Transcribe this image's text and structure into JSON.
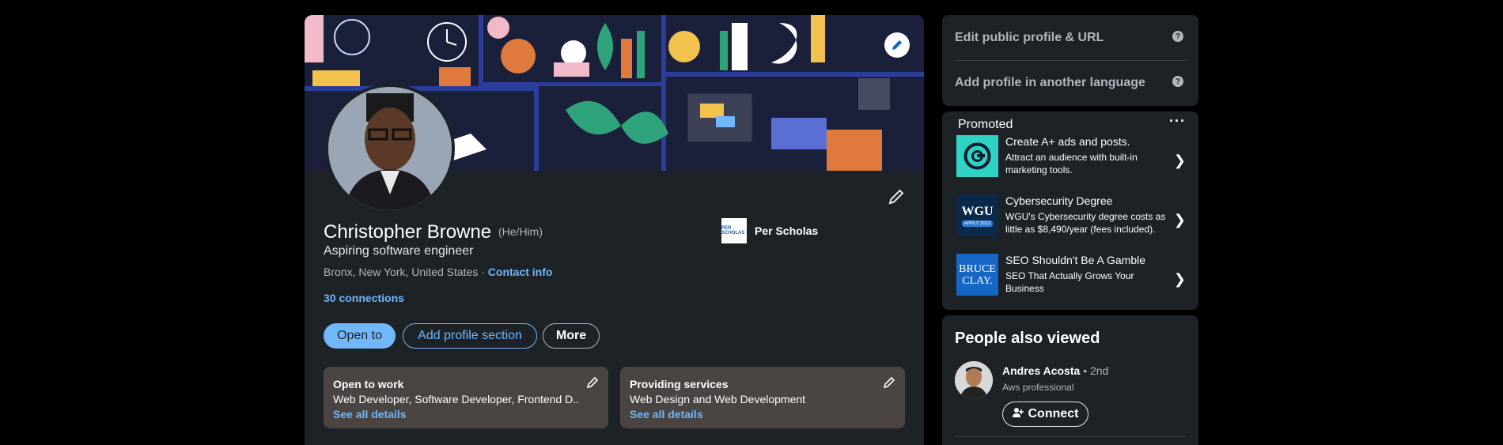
{
  "profile": {
    "name": "Christopher Browne",
    "pronouns": "(He/Him)",
    "headline": "Aspiring software engineer",
    "location": "Bronx, New York, United States",
    "location_separator": "·",
    "contact_info": "Contact info",
    "connections": "30 connections",
    "company": "Per Scholas",
    "company_logo_text": "PER SCHOLAS"
  },
  "actions": {
    "open_to": "Open to",
    "add_profile_section": "Add profile section",
    "more": "More"
  },
  "info_boxes": [
    {
      "title": "Open to work",
      "description": "Web Developer, Software Developer, Frontend D...",
      "link": "See all details"
    },
    {
      "title": "Providing services",
      "description": "Web Design and Web Development",
      "link": "See all details"
    }
  ],
  "sidebar": {
    "edit_public_profile": "Edit public profile & URL",
    "add_language": "Add profile in another language",
    "help_glyph": "?"
  },
  "promoted": {
    "label": "Promoted",
    "menu_glyph": "···",
    "ads": [
      {
        "title": "Create A+ ads and posts.",
        "description": "Attract an audience with built-in marketing tools.",
        "logo_color": "#2ed3c6",
        "icon": "wix-style-g-logo"
      },
      {
        "title": "Cybersecurity Degree",
        "description": "WGU's Cybersecurity degree costs as little as $8,490/year (fees included).",
        "logo_text": "WGU",
        "logo_subtext": "APPLY 2022",
        "logo_color": "#0b2a4a"
      },
      {
        "title": "SEO Shouldn't Be A Gamble",
        "description": "SEO That Actually Grows Your Business",
        "logo_text_1": "BRUCE",
        "logo_text_2": "CLAY.",
        "logo_color": "#1666c5"
      }
    ],
    "chevron": "❯"
  },
  "people_also_viewed": {
    "title": "People also viewed",
    "people": [
      {
        "name": "Andres Acosta",
        "degree": "• 2nd",
        "description": "Aws professional",
        "connect_label": "Connect"
      }
    ]
  },
  "colors": {
    "accent_blue": "#71b7fb",
    "card_bg": "#1d2226",
    "info_box_bg": "#4a4542"
  }
}
